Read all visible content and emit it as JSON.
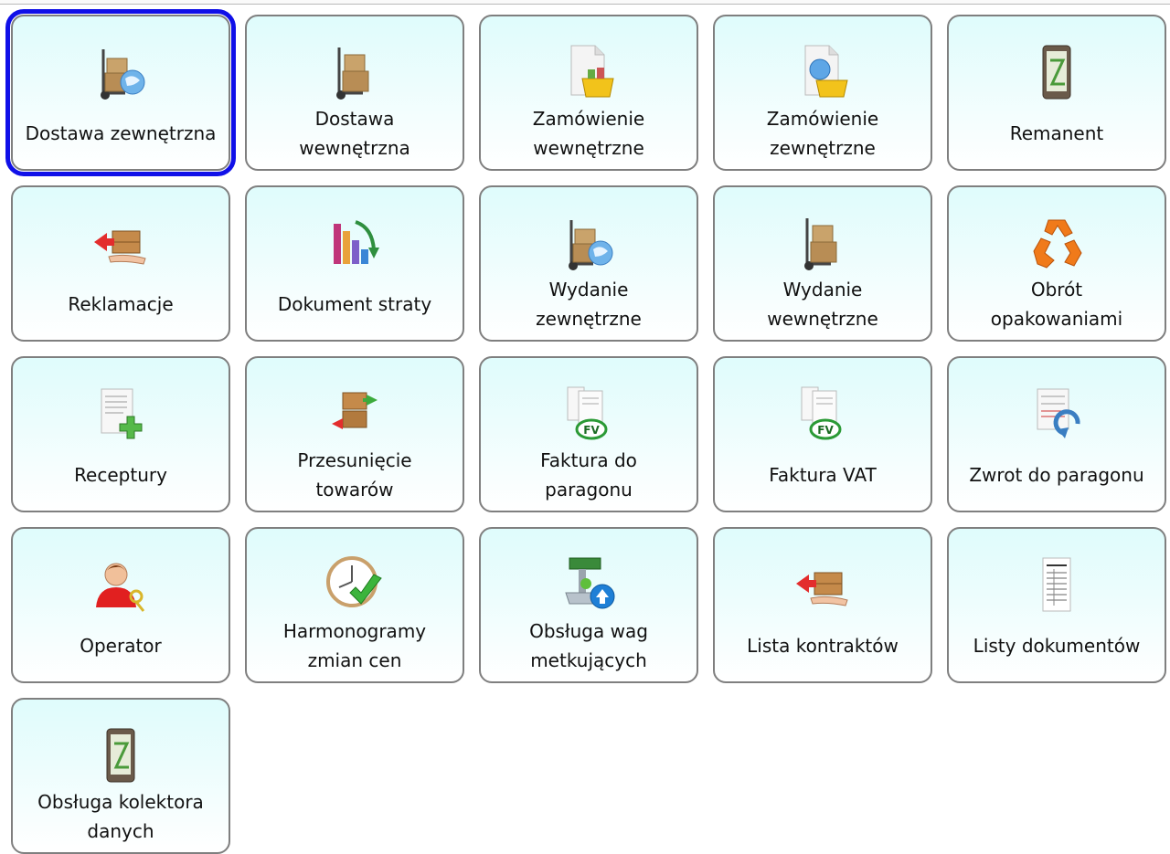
{
  "tiles": [
    {
      "label": "Dostawa zewnętrzna",
      "icon": "hand-truck-globe-icon"
    },
    {
      "label": "Dostawa\nwewnętrzna",
      "icon": "hand-truck-icon"
    },
    {
      "label": "Zamówienie\nwewnętrzne",
      "icon": "order-document-basket-icon"
    },
    {
      "label": "Zamówienie\nzewnętrzne",
      "icon": "order-document-globe-icon"
    },
    {
      "label": "Remanent",
      "icon": "data-collector-icon"
    },
    {
      "label": "Reklamacje",
      "icon": "box-return-hand-icon"
    },
    {
      "label": "Dokument straty",
      "icon": "bar-chart-decline-icon"
    },
    {
      "label": "Wydanie\nzewnętrzne",
      "icon": "hand-truck-globe-icon"
    },
    {
      "label": "Wydanie\nwewnętrzne",
      "icon": "hand-truck-icon"
    },
    {
      "label": "Obrót\nopakowaniami",
      "icon": "recycle-icon"
    },
    {
      "label": "Receptury",
      "icon": "document-plus-icon"
    },
    {
      "label": "Przesunięcie\ntowarów",
      "icon": "boxes-transfer-icon"
    },
    {
      "label": "Faktura do\nparagonu",
      "icon": "invoice-fv-icon"
    },
    {
      "label": "Faktura VAT",
      "icon": "invoice-fv-icon"
    },
    {
      "label": "Zwrot do paragonu",
      "icon": "document-return-icon"
    },
    {
      "label": "Operator",
      "icon": "user-keys-icon"
    },
    {
      "label": "Harmonogramy\nzmian cen",
      "icon": "clock-check-icon"
    },
    {
      "label": "Obsługa wag\nmetkujących",
      "icon": "scale-upload-icon"
    },
    {
      "label": "Lista kontraktów",
      "icon": "box-return-hand-icon"
    },
    {
      "label": "Listy dokumentów",
      "icon": "document-list-icon"
    },
    {
      "label": "Obsługa kolektora\ndanych",
      "icon": "data-collector-icon"
    }
  ],
  "selected_index": 0,
  "fv_badge": "FV",
  "colors": {
    "tile_top": "#dffcfc",
    "tile_border": "#7f7f7f",
    "selection": "#1010e8"
  }
}
